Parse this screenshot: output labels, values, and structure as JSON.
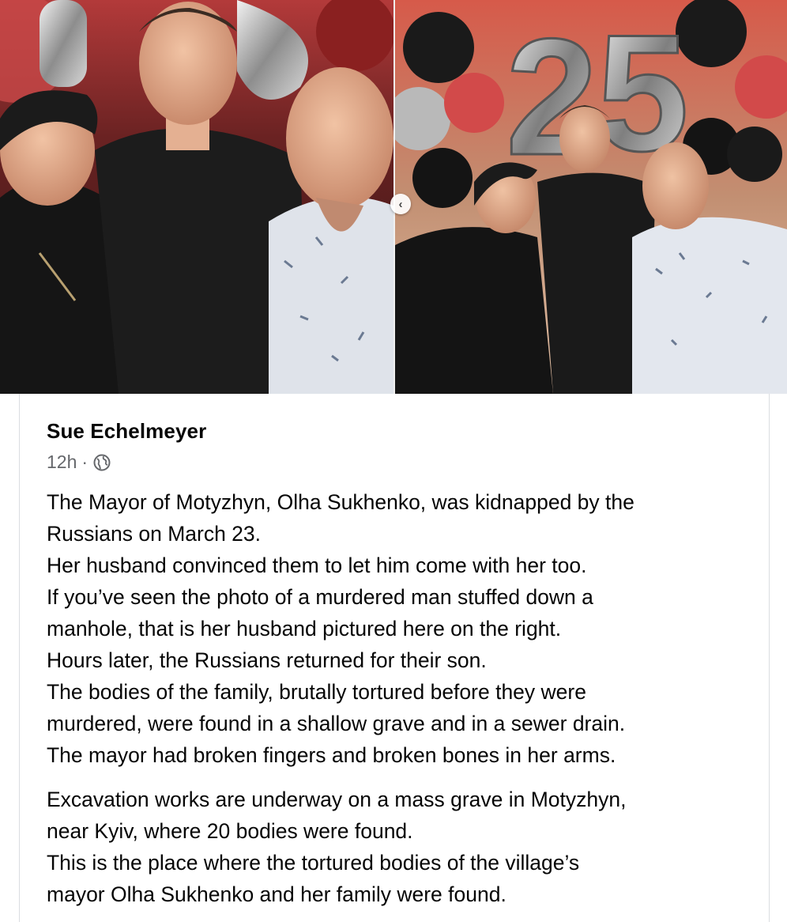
{
  "post": {
    "author": "Sue Echelmeyer",
    "time": "12h",
    "separator": "·",
    "privacy_icon": "globe-icon",
    "paragraph_1": [
      "The Mayor of Motyzhyn, Olha Sukhenko, was kidnapped by the",
      "Russians on March 23.",
      "Her husband convinced them to let him come with her too.",
      "If you’ve seen the photo of a murdered man stuffed down a",
      "manhole, that is her husband pictured here on the right.",
      "Hours later, the Russians returned for their son.",
      "The bodies of the family, brutally tortured before they were",
      "murdered, were found in a shallow grave and in a sewer drain.",
      "The mayor had broken fingers and broken bones in her arms."
    ],
    "paragraph_2": [
      "Excavation works are underway on a mass grave in Motyzhyn,",
      "near Kyiv, where 20 bodies were found.",
      "This is the place where the tortured bodies of the village’s",
      "mayor Olha Sukhenko and her family were found."
    ]
  },
  "photos": {
    "left_alt": "photo-family-closeup",
    "right_alt": "photo-family-birthday-balloons",
    "balloon_number": "25",
    "prev_icon": "chevron-left-icon",
    "prev_glyph": "‹"
  },
  "colors": {
    "text": "#050505",
    "meta": "#65676b",
    "border": "#dadde1"
  }
}
